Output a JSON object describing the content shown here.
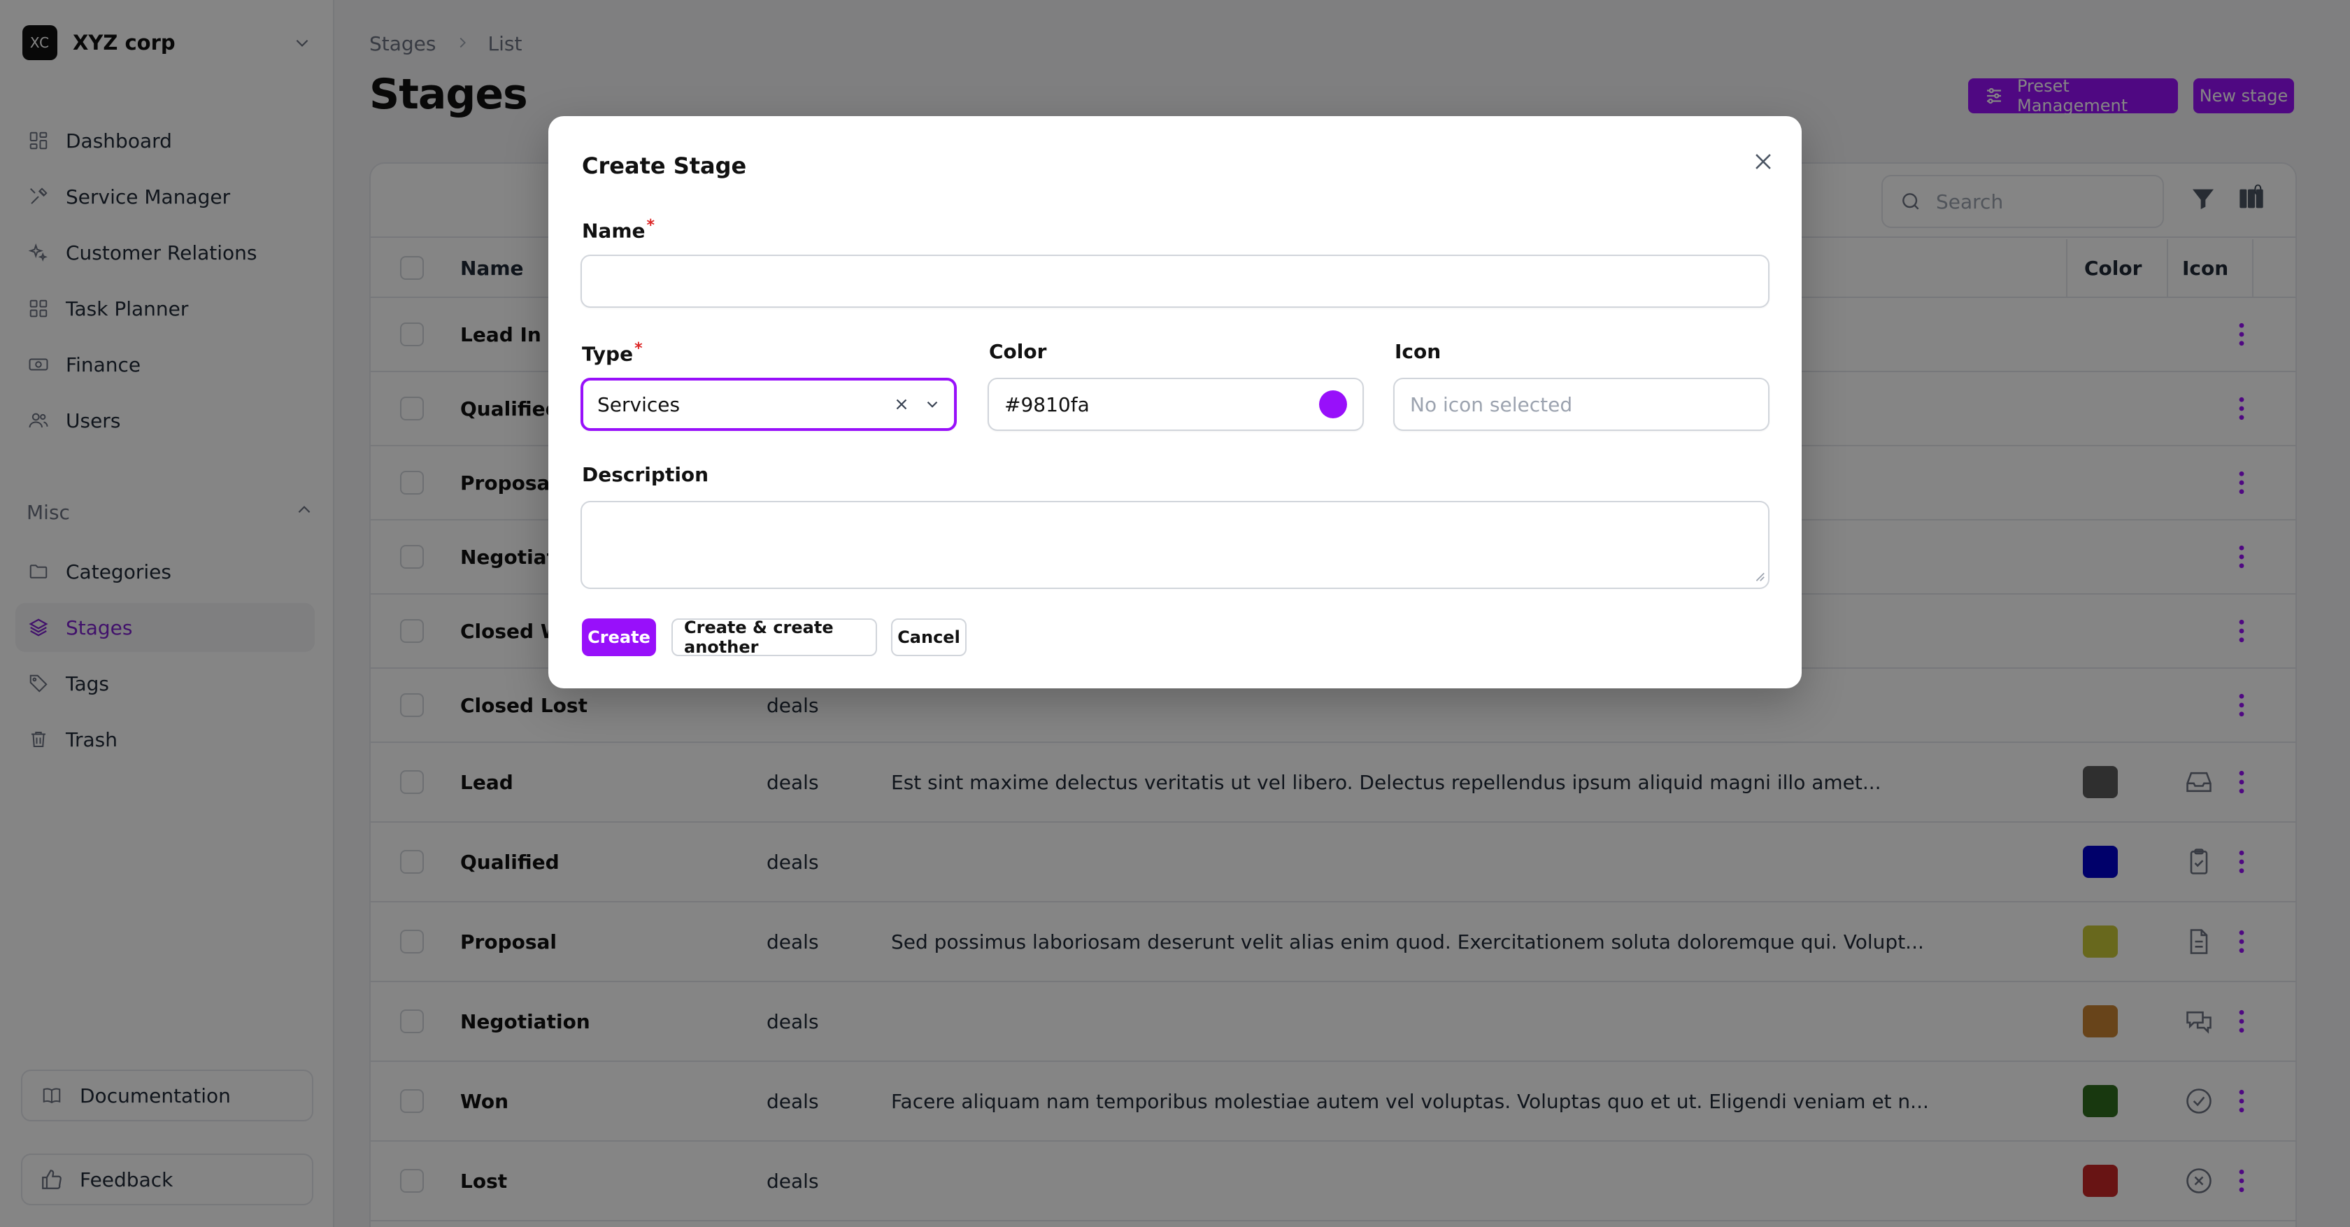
{
  "brand": {
    "logo": "XC",
    "name": "XYZ corp"
  },
  "nav": [
    {
      "label": "Dashboard",
      "icon": "dashboard-icon"
    },
    {
      "label": "Service Manager",
      "icon": "tools-icon"
    },
    {
      "label": "Customer Relations",
      "icon": "sparkles-icon"
    },
    {
      "label": "Task Planner",
      "icon": "grid-icon"
    },
    {
      "label": "Finance",
      "icon": "banknote-icon"
    },
    {
      "label": "Users",
      "icon": "users-icon"
    }
  ],
  "misc_group": {
    "label": "Misc"
  },
  "misc_nav": [
    {
      "label": "Categories",
      "icon": "folder-icon"
    },
    {
      "label": "Stages",
      "icon": "layers-icon",
      "active": true
    },
    {
      "label": "Tags",
      "icon": "tag-icon"
    },
    {
      "label": "Trash",
      "icon": "trash-icon"
    }
  ],
  "side_buttons": {
    "documentation": "Documentation",
    "feedback": "Feedback"
  },
  "breadcrumb": {
    "first": "Stages",
    "second": "List"
  },
  "page_title": "Stages",
  "header_buttons": {
    "preset": "Preset Management",
    "new_stage": "New stage"
  },
  "toolbar": {
    "search_placeholder": "Search",
    "filter_count": "0"
  },
  "table": {
    "columns": {
      "name": "Name",
      "color": "Color",
      "icon": "Icon"
    },
    "rows": [
      {
        "name": "Lead In",
        "type": "",
        "description": "",
        "color": "",
        "icon": ""
      },
      {
        "name": "Qualified",
        "type": "",
        "description": "",
        "color": "",
        "icon": ""
      },
      {
        "name": "Proposal S",
        "type": "",
        "description": "",
        "color": "",
        "icon": ""
      },
      {
        "name": "Negotiatio",
        "type": "",
        "description": "",
        "color": "",
        "icon": ""
      },
      {
        "name": "Closed Wo",
        "type": "",
        "description": "",
        "color": "",
        "icon": ""
      },
      {
        "name": "Closed Lost",
        "type": "deals",
        "description": "",
        "color": "",
        "icon": ""
      },
      {
        "name": "Lead",
        "type": "deals",
        "description": "Est sint maxime delectus veritatis ut vel libero. Delectus repellendus ipsum aliquid magni illo amet...",
        "color": "#5b5b5b",
        "icon": "inbox-icon"
      },
      {
        "name": "Qualified",
        "type": "deals",
        "description": "",
        "color": "#0000cc",
        "icon": "clipboard-check-icon"
      },
      {
        "name": "Proposal",
        "type": "deals",
        "description": "Sed possimus laboriosam deserunt velit alias enim quod. Exercitationem soluta doloremque qui. Volupt...",
        "color": "#c8c838",
        "icon": "document-icon"
      },
      {
        "name": "Negotiation",
        "type": "deals",
        "description": "",
        "color": "#c88232",
        "icon": "chat-bubbles-icon"
      },
      {
        "name": "Won",
        "type": "deals",
        "description": "Facere aliquam nam temporibus molestiae autem vel voluptas. Voluptas quo et ut. Eligendi veniam et n...",
        "color": "#2e6b1e",
        "icon": "check-circle-icon"
      },
      {
        "name": "Lost",
        "type": "deals",
        "description": "",
        "color": "#c82828",
        "icon": "x-circle-icon"
      }
    ]
  },
  "modal": {
    "title": "Create Stage",
    "name_label": "Name",
    "name_value": "",
    "type_label": "Type",
    "type_value": "Services",
    "color_label": "Color",
    "color_value": "#9810fa",
    "icon_label": "Icon",
    "icon_placeholder": "No icon selected",
    "description_label": "Description",
    "buttons": {
      "create": "Create",
      "create_another": "Create & create another",
      "cancel": "Cancel"
    }
  },
  "colors": {
    "accent": "#9810fa",
    "overlay": "rgba(0,0,0,0.48)"
  }
}
